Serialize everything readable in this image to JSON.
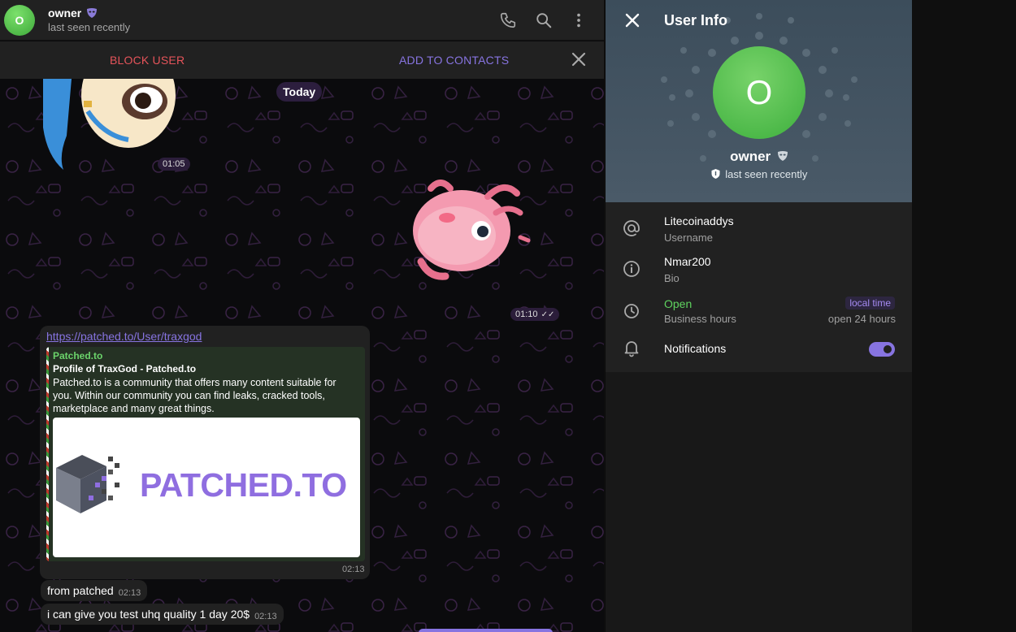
{
  "colors": {
    "accent": "#8774e1",
    "danger": "#e5545a",
    "online_green": "#5fd35f",
    "avatar_green": "#4cbf42"
  },
  "header": {
    "avatar_letter": "O",
    "name": "owner",
    "name_badge_icon": "mask-icon",
    "status": "last seen recently",
    "icons": [
      "phone-icon",
      "search-icon",
      "more-vertical-icon"
    ]
  },
  "action_bar": {
    "block_label": "BLOCK USER",
    "add_label": "ADD TO CONTACTS",
    "close_icon": "close-icon"
  },
  "chat": {
    "date_label": "Today",
    "sticker1_time": "01:05",
    "sticker2_time": "01:10",
    "link_message": {
      "url": "https://patched.to/User/traxgod",
      "preview_site": "Patched.to",
      "preview_title": "Profile of TraxGod - Patched.to",
      "preview_desc": "Patched.to is a community that offers many content suitable for you. Within our community you can find leaks, cracked tools, marketplace and many great things.",
      "preview_logo": "PATCHED.TO",
      "time": "02:13"
    },
    "messages": [
      {
        "text": "from patched",
        "time": "02:13"
      },
      {
        "text": "i can give you test uhq quality 1 day 20$",
        "time": "02:13"
      }
    ]
  },
  "info_panel": {
    "title": "User Info",
    "avatar_letter": "O",
    "name": "owner",
    "status": "last seen recently",
    "rows": {
      "username_value": "Litecoinaddys",
      "username_label": "Username",
      "bio_value": "Nmar200",
      "bio_label": "Bio",
      "hours_value": "Open",
      "hours_label": "Business hours",
      "hours_badge": "local time",
      "hours_detail": "open 24 hours",
      "notifications_label": "Notifications",
      "notifications_on": true
    }
  }
}
